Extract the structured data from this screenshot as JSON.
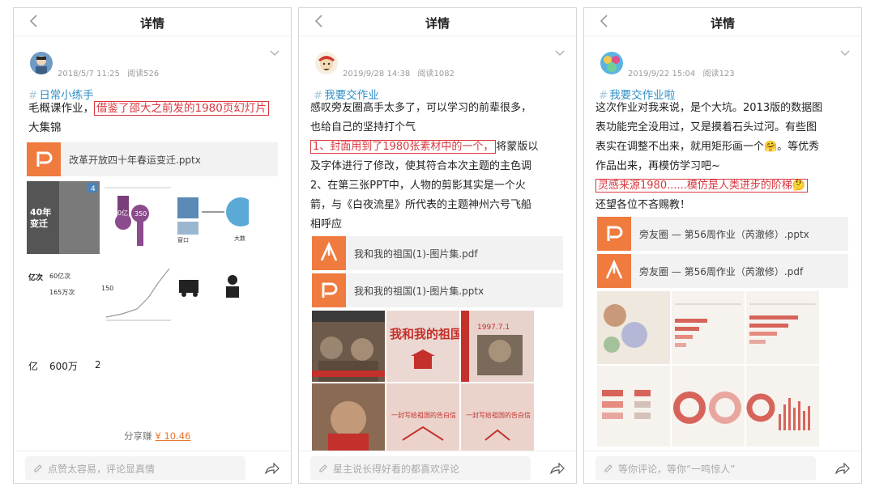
{
  "screens": [
    {
      "header": {
        "title": "详情"
      },
      "post": {
        "date": "2018/5/7 11:25",
        "views": "阅读526",
        "topic": "日常小练手",
        "lines": [
          {
            "pre": "毛概课作业，",
            "hl": "借鉴了邵大之前发的1980页幻灯片",
            "post": ""
          },
          {
            "pre": "大集锦",
            "hl": "",
            "post": ""
          }
        ],
        "files": [
          {
            "name": "改革开放四十年春运变迁.pptx",
            "icon": "pptx-file-icon"
          }
        ],
        "thumb_text": {
          "a1": "40年",
          "a2": "变迁",
          "b1": "0亿",
          "b2": "350",
          "c1": "窗口",
          "c2": "大数",
          "d1": "亿次",
          "d2": "60亿次",
          "d3": "165万次",
          "d4": "150",
          "f1": "亿",
          "f2": "600万",
          "f3": "2"
        },
        "share_label": "分享赚",
        "share_amount": "¥ 10.46"
      },
      "footer": {
        "comment_placeholder": "点赞太容易，评论显真情"
      }
    },
    {
      "header": {
        "title": "详情"
      },
      "post": {
        "date": "2019/9/28 14:38",
        "views": "阅读1082",
        "topic": "我要交作业",
        "lines": [
          {
            "pre": "感叹旁友圈高手太多了，可以学习的前辈很多，",
            "hl": "",
            "post": ""
          },
          {
            "pre": "也给自己的坚持打个气",
            "hl": "",
            "post": ""
          },
          {
            "pre": "",
            "hl": "1、封面用到了1980张素材中的一个，",
            "post": "将蒙版以"
          },
          {
            "pre": "及字体进行了修改，使其符合本次主题的主色调",
            "hl": "",
            "post": ""
          },
          {
            "pre": "2、在第三张PPT中，人物的剪影其实是一个火",
            "hl": "",
            "post": ""
          },
          {
            "pre": "箭，与《白夜流星》所代表的主题神州六号飞船",
            "hl": "",
            "post": ""
          },
          {
            "pre": "相呼应",
            "hl": "",
            "post": ""
          }
        ],
        "files": [
          {
            "name": "我和我的祖国(1)-图片集.pdf",
            "icon": "pdf-file-icon"
          },
          {
            "name": "我和我的祖国(1)-图片集.pptx",
            "icon": "pptx-file-icon"
          }
        ],
        "thumb_text": {
          "t1": "我和我的祖国",
          "t2": "1997.7.1",
          "t3": "一封写给祖国的告白信"
        }
      },
      "footer": {
        "comment_placeholder": "星主说长得好看的都喜欢评论"
      }
    },
    {
      "header": {
        "title": "详情"
      },
      "post": {
        "date": "2019/9/22 15:04",
        "views": "阅读123",
        "topic": "我要交作业啦",
        "lines": [
          {
            "pre": "这次作业对我来说，是个大坑。2013版的数据图",
            "hl": "",
            "post": ""
          },
          {
            "pre": "表功能完全没用过，又是摸着石头过河。有些图",
            "hl": "",
            "post": ""
          },
          {
            "pre": "表实在调整不出来，就用矩形画一个🤗。等优秀",
            "hl": "",
            "post": ""
          },
          {
            "pre": "作品出来，再模仿学习吧~",
            "hl": "",
            "post": ""
          },
          {
            "pre": "",
            "hl": "灵感来源1980......模仿是人类进步的阶梯🤔",
            "post": ""
          },
          {
            "pre": "还望各位不吝赐教！",
            "hl": "",
            "post": ""
          }
        ],
        "files": [
          {
            "name": "旁友圈 — 第56周作业（芮澈修）.pptx",
            "icon": "pptx-file-icon"
          },
          {
            "name": "旁友圈 — 第56周作业（芮澈修）.pdf",
            "icon": "pdf-file-icon"
          }
        ]
      },
      "footer": {
        "comment_placeholder": "等你评论，等你“一鸣惊人”"
      }
    }
  ],
  "colors": {
    "topic": "#2f8ec6",
    "highlight_border": "#d9363e",
    "file_icon_bg": "#f07b3f",
    "share_amount": "#e8762d"
  }
}
